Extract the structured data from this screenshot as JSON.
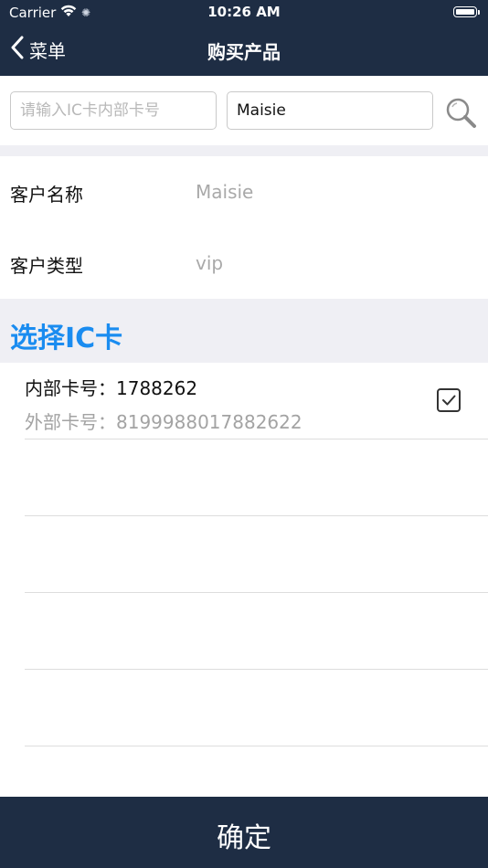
{
  "status_bar": {
    "carrier": "Carrier",
    "time": "10:26 AM"
  },
  "nav": {
    "back_label": "菜单",
    "title": "购买产品",
    "background_color": "#1e2d44"
  },
  "search": {
    "card_placeholder": "请输入IC卡内部卡号",
    "card_value": "",
    "name_value": "Maisie",
    "icon": "search-icon"
  },
  "customer": {
    "name_label": "客户名称",
    "name_value": "Maisie",
    "type_label": "客户类型",
    "type_value": "vip"
  },
  "section": {
    "title": "选择IC卡",
    "accent_color": "#1a8cf0"
  },
  "cards": [
    {
      "inner": "内部卡号：1788262",
      "outer": "外部卡号：819998801788262​2",
      "checked": true
    }
  ],
  "confirm_label": "确定"
}
